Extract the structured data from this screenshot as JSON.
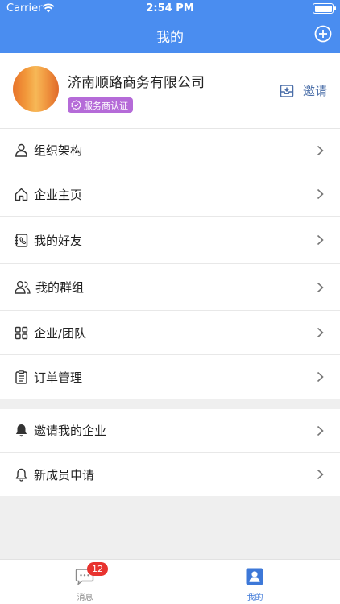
{
  "status_bar": {
    "carrier": "Carrier",
    "time": "2:54 PM"
  },
  "header": {
    "title": "我的"
  },
  "profile": {
    "company_name": "济南顺路商务有限公司",
    "badge": "服务商认证",
    "invite_label": "邀请"
  },
  "menu_groups": [
    [
      {
        "label": "组织架构",
        "icon": "person-icon"
      },
      {
        "label": "企业主页",
        "icon": "home-icon"
      },
      {
        "label": "我的好友",
        "icon": "contacts-icon"
      },
      {
        "label": "我的群组",
        "icon": "group-icon"
      },
      {
        "label": "企业/团队",
        "icon": "grid-icon"
      },
      {
        "label": "订单管理",
        "icon": "clipboard-icon"
      }
    ],
    [
      {
        "label": "邀请我的企业",
        "icon": "bell-filled-icon"
      },
      {
        "label": "新成员申请",
        "icon": "bell-outline-icon"
      }
    ]
  ],
  "tabbar": {
    "tabs": [
      {
        "label": "消息",
        "badge": "12",
        "icon": "message-icon"
      },
      {
        "label": "我的",
        "icon": "profile-card-icon"
      }
    ]
  },
  "colors": {
    "brand_blue": "#4a8df0",
    "badge_purple": "#b56bd8",
    "invite_text": "#4a6ea8",
    "alert_red": "#e8332f",
    "active_tab": "#3d78d8",
    "inactive_tab": "#8a8a8a"
  }
}
